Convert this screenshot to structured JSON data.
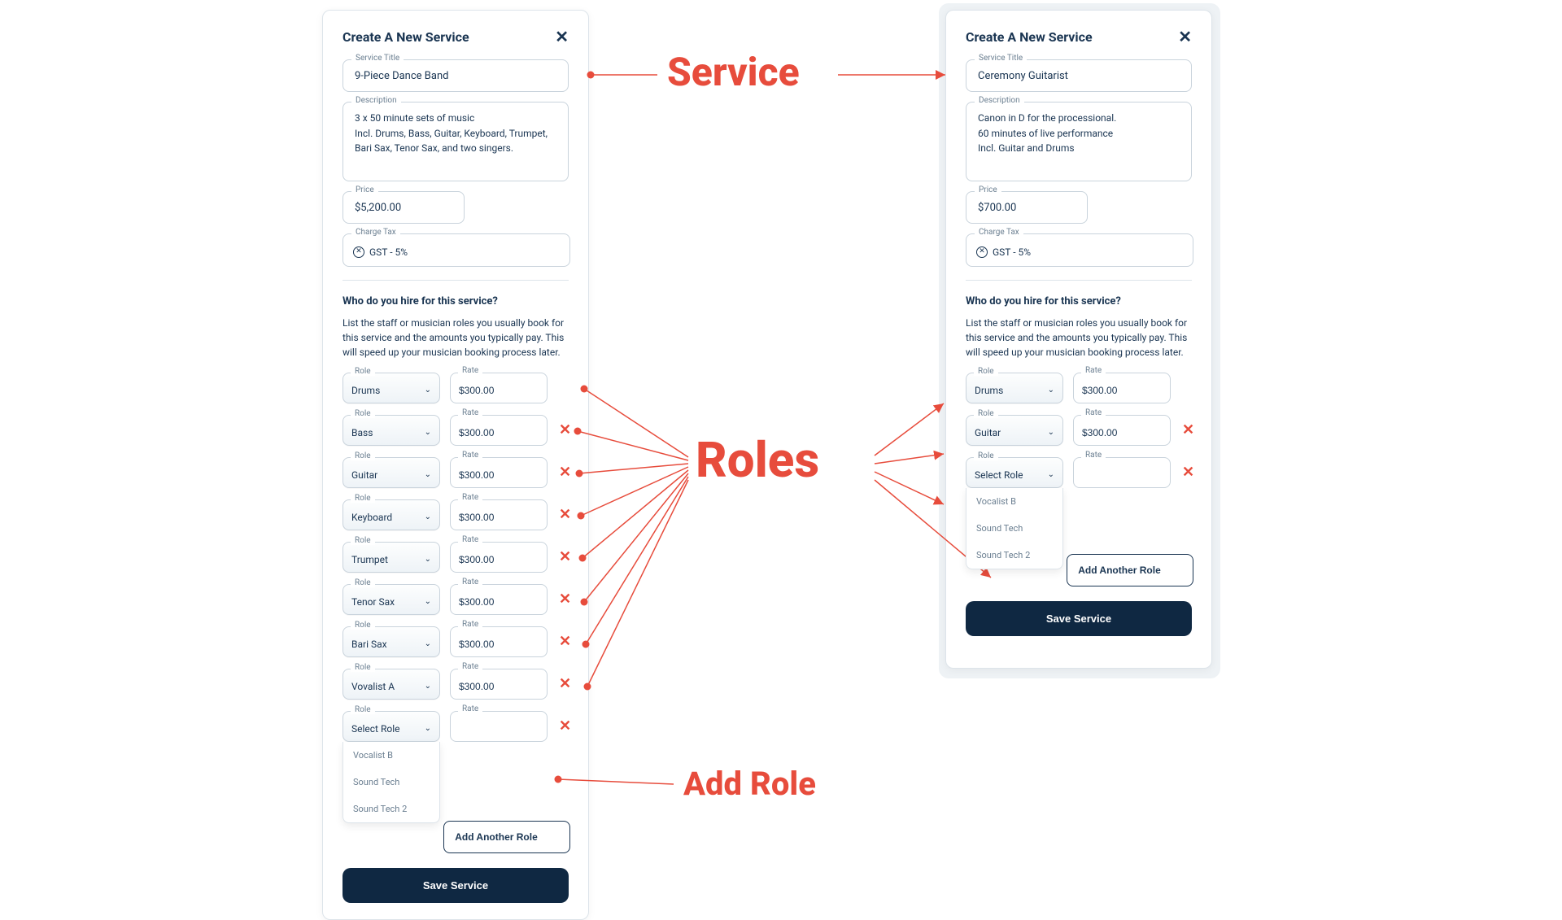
{
  "annotations": {
    "service": "Service",
    "roles": "Roles",
    "add_role": "Add Role"
  },
  "dialog_title": "Create A New Service",
  "labels": {
    "service_title": "Service Title",
    "description": "Description",
    "price": "Price",
    "charge_tax": "Charge Tax",
    "role": "Role",
    "rate": "Rate",
    "select_role": "Select Role"
  },
  "buttons": {
    "add_role": "Add Another Role",
    "save": "Save Service"
  },
  "section": {
    "heading": "Who do you hire for this service?",
    "desc": "List the staff or musician roles you usually book for this service and the amounts you typically pay. This will speed up your musician booking process later."
  },
  "tax_chip": "GST - 5%",
  "dropdown_options": [
    "Vocalist B",
    "Sound Tech",
    "Sound Tech 2"
  ],
  "left": {
    "title_value": "9-Piece Dance Band",
    "description_value": "3 x 50 minute sets of music\nIncl. Drums, Bass, Guitar, Keyboard, Trumpet, Bari Sax, Tenor Sax, and two singers.",
    "price_value": "$5,200.00",
    "roles": [
      {
        "role": "Drums",
        "rate": "$300.00",
        "remove": false
      },
      {
        "role": "Bass",
        "rate": "$300.00",
        "remove": true
      },
      {
        "role": "Guitar",
        "rate": "$300.00",
        "remove": true
      },
      {
        "role": "Keyboard",
        "rate": "$300.00",
        "remove": true
      },
      {
        "role": "Trumpet",
        "rate": "$300.00",
        "remove": true
      },
      {
        "role": "Tenor Sax",
        "rate": "$300.00",
        "remove": true
      },
      {
        "role": "Bari Sax",
        "rate": "$300.00",
        "remove": true
      },
      {
        "role": "Vovalist A",
        "rate": "$300.00",
        "remove": true
      }
    ]
  },
  "right": {
    "title_value": "Ceremony Guitarist",
    "description_value": "Canon in D for the processional.\n60 minutes of live performance\nIncl. Guitar and Drums",
    "price_value": "$700.00",
    "roles": [
      {
        "role": "Drums",
        "rate": "$300.00",
        "remove": false
      },
      {
        "role": "Guitar",
        "rate": "$300.00",
        "remove": true
      }
    ]
  }
}
